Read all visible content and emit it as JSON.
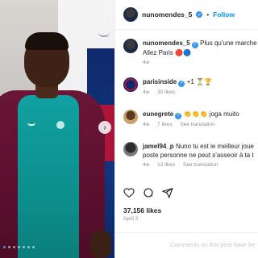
{
  "post": {
    "username": "nunomendes_5",
    "follow_label": "Follow",
    "dot": "•",
    "caption_line1": "Plus qu'une marche",
    "caption_line2": "Allez Paris 🔴🔵",
    "caption_age": "4w"
  },
  "comments": [
    {
      "user": "parisinside",
      "text": "+1 ⏳🏆",
      "age": "4w",
      "likes": "30 likes",
      "translate": ""
    },
    {
      "user": "eunegrete",
      "text": "👏👏👏 joga muito",
      "age": "4w",
      "likes": "7 likes",
      "translate": "See translation"
    },
    {
      "user": "jamel94_p",
      "text": "Nuno tu est le meilleur joue",
      "text2": "poste personne ne peut s'asseoir à ta t",
      "age": "4w",
      "likes": "13 likes",
      "translate": "See translation"
    }
  ],
  "stats": {
    "likes": "37,156 likes",
    "date": "April 2"
  },
  "footer": {
    "limited_text": "Comments on this post have be"
  },
  "icons": [
    "heart-icon",
    "comment-icon",
    "share-icon",
    "verified-icon",
    "chevron-right-icon"
  ],
  "colors": {
    "accent": "#0095f6",
    "verified": "#3897f0",
    "muted": "#8e8e8e"
  }
}
